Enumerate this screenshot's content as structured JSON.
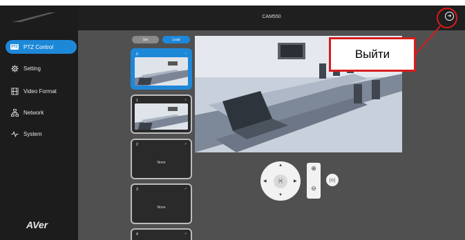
{
  "app": {
    "title": "CAM550"
  },
  "sidebar": {
    "items": [
      {
        "label": "PTZ Control",
        "badge": "PTZ",
        "active": true
      },
      {
        "label": "Setting"
      },
      {
        "label": "Video Format"
      },
      {
        "label": "Network"
      },
      {
        "label": "System"
      }
    ],
    "logo": "AVer"
  },
  "presets": {
    "set_label": "Set",
    "load_label": "Load",
    "items": [
      {
        "number": "0",
        "has_thumbnail": true,
        "selected": true
      },
      {
        "number": "1",
        "has_thumbnail": true,
        "selected": false
      },
      {
        "number": "2",
        "none_label": "None"
      },
      {
        "number": "3",
        "none_label": "None"
      },
      {
        "number": "4",
        "has_thumbnail": true
      }
    ]
  },
  "annotation": {
    "callout_text": "Выйти",
    "color": "#d81c1c"
  },
  "colors": {
    "accent": "#1e88d8",
    "sidebar_bg": "#1c1c1c",
    "main_bg": "#505050"
  }
}
